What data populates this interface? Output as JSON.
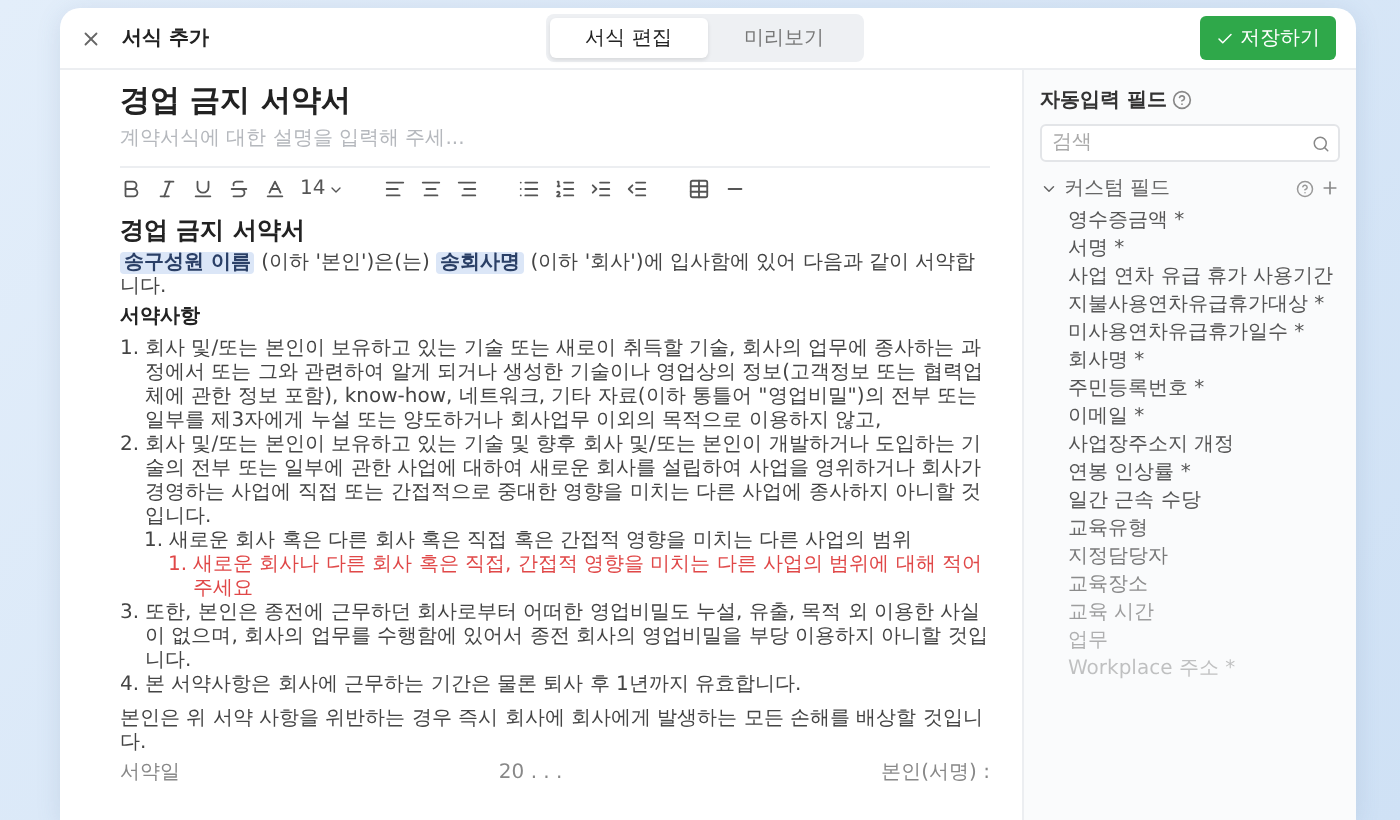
{
  "window": {
    "title": "서식 추가"
  },
  "mode_tabs": [
    {
      "label": "서식 편집",
      "selected": true
    },
    {
      "label": "미리보기",
      "selected": false
    }
  ],
  "save_button": {
    "label": "저장하기"
  },
  "form": {
    "title": "경업 금지 서약서",
    "description": {
      "placeholder": "계약서식에 대한 설명을 입력해 주세..."
    }
  },
  "toolbar": {
    "font_size": "14"
  },
  "document": {
    "heading": "경업 금지 서약서",
    "intro": [
      {
        "kind": "field",
        "text": "송구성원 이름"
      },
      {
        "kind": "text",
        "text": " (이하 '본인')은(는) "
      },
      {
        "kind": "field",
        "text": "송회사명"
      },
      {
        "kind": "text",
        "text": " (이하 '회사')에 입사함에 있어 다음과 같이 서약합니다."
      }
    ],
    "section_title": "서약사항",
    "items": [
      {
        "number": "1.",
        "kind": "normal",
        "text": "회사 및/또는 본인이 보유하고 있는 기술 또는 새로이 취득할 기술, 회사의 업무에 종사하는 과정에서 또는 그와 관련하여 알게 되거나 생성한 기술이나 영업상의 정보(고객정보 또는 협력업체에 관한 정보 포함), know-how, 네트워크, 기타 자료(이하 통틀어 \"영업비밀\")의 전부 또는 일부를 제3자에게 누설 또는 양도하거나 회사업무 이외의 목적으로 이용하지 않고,"
      },
      {
        "number": "2.",
        "kind": "normal",
        "text": "회사 및/또는 본인이 보유하고 있는 기술 및 향후 회사 및/또는 본인이 개발하거나 도입하는 기술의 전부 또는 일부에 관한 사업에 대하여 새로운 회사를 설립하여 사업을 영위하거나 회사가 경영하는 사업에 직접 또는 간접적으로 중대한 영향을 미치는 다른 사업에 종사하지 아니할 것입니다.",
        "children": [
          {
            "number": "1.",
            "kind": "normal",
            "text": "새로운 회사 혹은 다른 회사 혹은 직접 혹은 간접적 영향을 미치는 다른 사업의 범위",
            "children": [
              {
                "number": "1.",
                "kind": "note",
                "text": "새로운 회사나 다른 회사 혹은 직접, 간접적 영향을 미치는 다른 사업의 범위에 대해 적어주세요"
              }
            ]
          }
        ]
      },
      {
        "number": "3.",
        "kind": "normal",
        "text": "또한, 본인은 종전에 근무하던 회사로부터 어떠한 영업비밀도 누설, 유출, 목적 외 이용한 사실이 없으며, 회사의 업무를 수행함에 있어서 종전 회사의 영업비밀을 부당 이용하지 아니할 것입니다."
      },
      {
        "number": "4.",
        "kind": "normal",
        "text": "본 서약사항은 회사에 근무하는 기간은 물론 퇴사 후 1년까지 유효합니다."
      }
    ],
    "closing": "본인은 위 서약 사항을 위반하는 경우 즉시 회사에 회사에게 발생하는 모든 손해를 배상할 것입니다.",
    "signature": {
      "label": "서약일",
      "date": "20 . . .",
      "signer": "본인(서명) :"
    }
  },
  "sidebar": {
    "title": "자동입력 필드",
    "search": {
      "placeholder": "검색"
    },
    "group": {
      "label": "커스텀 필드",
      "expanded": true,
      "fields": [
        "영수증금액 *",
        "서명 *",
        "사업 연차 유급 휴가 사용기간",
        "지불사용연차유급휴가대상 *",
        "미사용연차유급휴가일수 *",
        "회사명 *",
        "주민등록번호 *",
        "이메일 *",
        "사업장주소지 개정",
        "연봉 인상률 *",
        "일간 근속 수당",
        "교육유형",
        "지정담당자",
        "교육장소",
        "교육 시간",
        "업무",
        "Workplace 주소 *"
      ]
    }
  }
}
